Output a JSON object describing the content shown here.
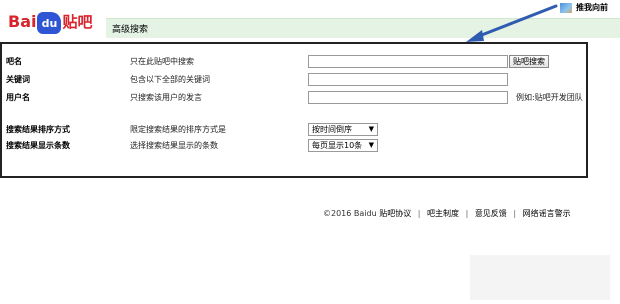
{
  "logo": {
    "part1": "Bai",
    "part2": "du",
    "part3": "贴吧"
  },
  "header": {
    "title": "高级搜索",
    "home_link": "推我向前"
  },
  "form": {
    "rows": [
      {
        "label": "吧名",
        "description": "只在此贴吧中搜索",
        "input_value": "",
        "button": "贴吧搜索"
      },
      {
        "label": "关键词",
        "description": "包含以下全部的关键词",
        "input_value": ""
      },
      {
        "label": "用户名",
        "description": "只搜索该用户的发言",
        "input_value": "",
        "hint": "例如:贴吧开发团队"
      },
      {
        "label": "搜索结果排序方式",
        "description": "限定搜索结果的排序方式是",
        "select_value": "按时间倒序"
      },
      {
        "label": "搜索结果显示条数",
        "description": "选择搜索结果显示的条数",
        "select_value": "每页显示10条"
      }
    ]
  },
  "footer": {
    "copyright": "©2016 Baidu",
    "links": [
      "贴吧协议",
      "吧主制度",
      "意见反馈",
      "网络谣言警示"
    ]
  },
  "colors": {
    "title_bar": "#e4f3e4",
    "arrow": "#2f5bb0",
    "logo_red": "#d8242d",
    "logo_blue": "#2f55d4"
  }
}
